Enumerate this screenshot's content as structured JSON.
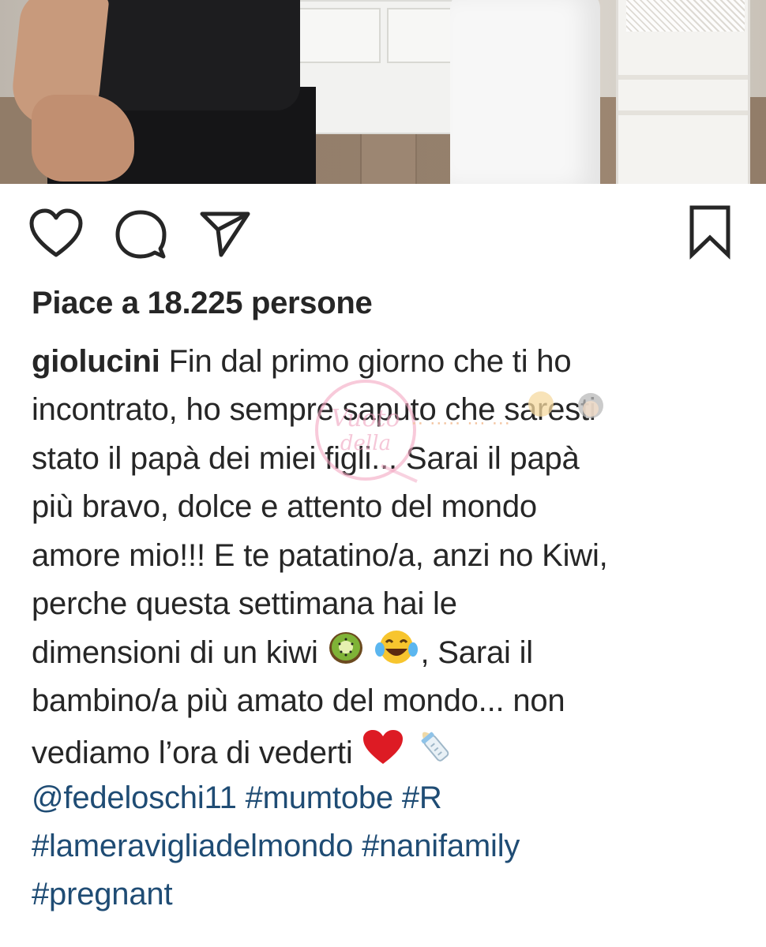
{
  "post": {
    "likes_text": "Piace a 18.225 persone",
    "username": "giolucini",
    "caption_lines": [
      "Fin dal primo giorno che ti ho",
      "incontrato, ho sempre saputo che saresti",
      "stato il papà dei miei figli... Sarai il papà",
      "più bravo, dolce e attento del mondo",
      "amore mio!!! E te patatino/a, anzi no Kiwi,",
      "perche questa settimana hai le",
      "dimensioni di un kiwi",
      ", Sarai il",
      "bambino/a più amato del mondo... non",
      "vediamo l’ora di vederti"
    ],
    "tags_line1": [
      "@fedeloschi11",
      "#mumtobe",
      "#R"
    ],
    "tags_line2": [
      "#lameravigliadelmondo",
      "#nanifamily"
    ],
    "tags_line3": [
      "#pregnant"
    ]
  },
  "icons": {
    "like": "heart-outline-icon",
    "comment": "speech-bubble-icon",
    "share": "paper-plane-icon",
    "save": "bookmark-icon",
    "emojis": [
      "kiwi-emoji",
      "laughing-tears-emoji",
      "red-heart-emoji",
      "baby-bottle-emoji"
    ]
  },
  "colors": {
    "text": "#262626",
    "hashtag": "#1f4c74",
    "icon_stroke": "#262626",
    "heart": "#dd1b24"
  }
}
